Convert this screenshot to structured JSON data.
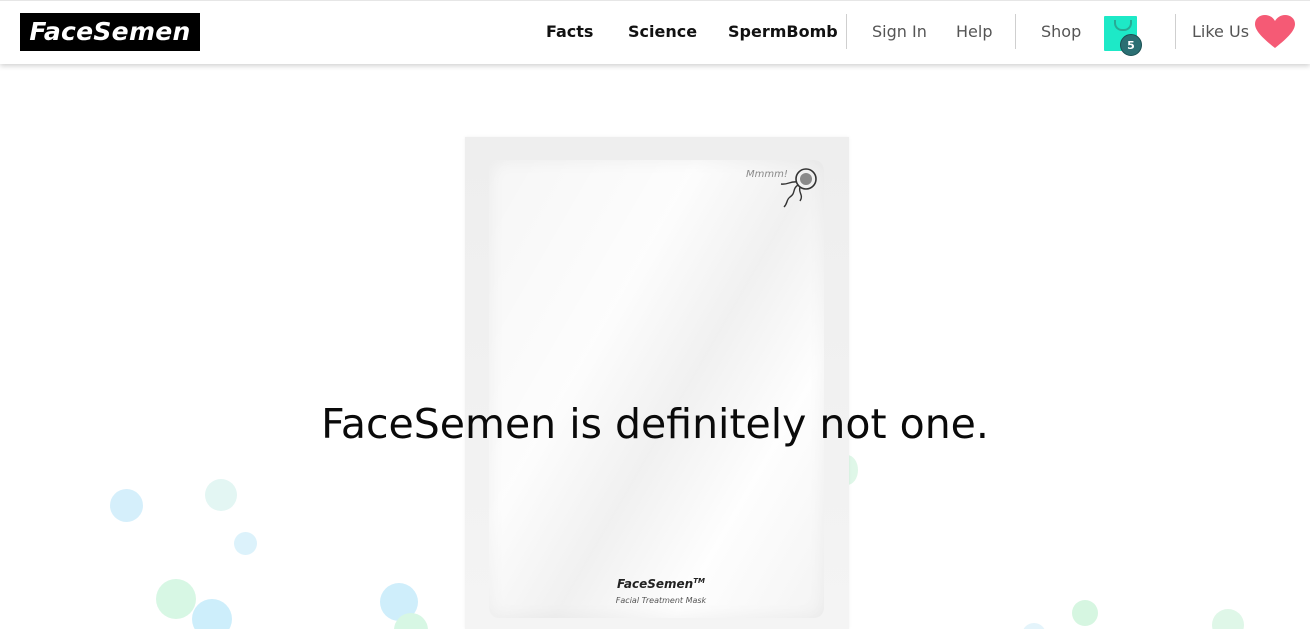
{
  "header": {
    "logo_text": "FaceSemen",
    "nav_primary": [
      {
        "label": "Facts"
      },
      {
        "label": "Science"
      },
      {
        "label": "SpermBomb"
      }
    ],
    "nav_secondary": [
      {
        "label": "Sign In"
      },
      {
        "label": "Help"
      },
      {
        "label": "Shop"
      }
    ],
    "cart": {
      "icon": "shopping-bag-icon",
      "count": "5",
      "color": "#1de9c7",
      "badge_color": "#2b6f73"
    },
    "like": {
      "label": "Like Us",
      "icon": "heart-icon",
      "color": "#f55a75"
    }
  },
  "hero": {
    "headline": "FaceSemen is definitely not one.",
    "packet": {
      "corner_text": "Mmmm!",
      "brand": "FaceSemen",
      "trademark": "TM",
      "subtitle": "Facial Treatment Mask"
    },
    "bubble_colors": [
      "#d9f1fb",
      "#d7f7e4",
      "#c8ecfb"
    ]
  }
}
